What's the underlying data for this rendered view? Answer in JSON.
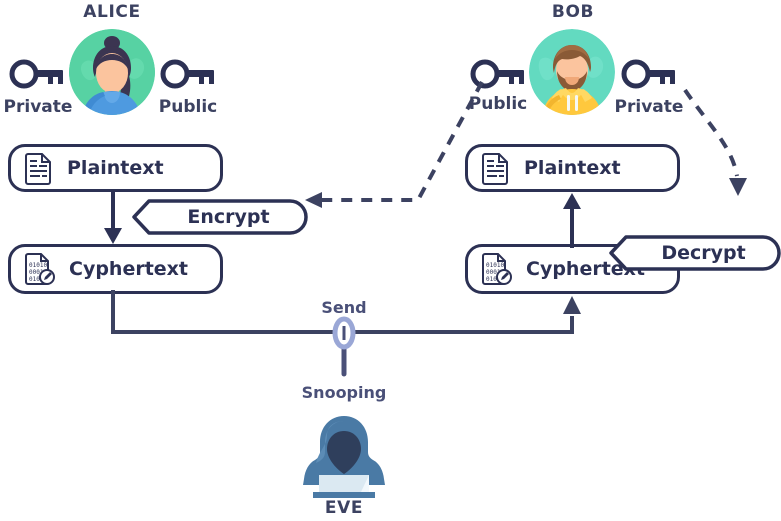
{
  "diagram": {
    "title_alice": "ALICE",
    "title_bob": "BOB",
    "title_eve": "EVE"
  },
  "alice": {
    "name": "ALICE",
    "private_key_label": "Private",
    "public_key_label": "Public",
    "avatar_icon": "woman-avatar-icon",
    "private_key_icon": "key-icon",
    "public_key_icon": "key-icon"
  },
  "bob": {
    "name": "BOB",
    "public_key_label": "Public",
    "private_key_label": "Private",
    "avatar_icon": "man-avatar-icon",
    "public_key_icon": "key-icon",
    "private_key_icon": "key-icon"
  },
  "eve": {
    "name": "EVE",
    "avatar_icon": "hacker-avatar-icon"
  },
  "left_flow": {
    "plaintext_label": "Plaintext",
    "plaintext_icon": "document-icon",
    "ciphertext_label": "Cyphertext",
    "ciphertext_icon": "encrypted-document-icon",
    "action_label": "Encrypt"
  },
  "right_flow": {
    "plaintext_label": "Plaintext",
    "plaintext_icon": "document-icon",
    "ciphertext_label": "Cyphertext",
    "ciphertext_icon": "encrypted-document-icon",
    "action_label": "Decrypt"
  },
  "channel": {
    "send_label": "Send",
    "snooping_label": "Snooping",
    "snooping_icon": "magnifying-glass-icon"
  },
  "colors": {
    "ink": "#2c3154",
    "muted_ink": "#3c4261",
    "mid_ink": "#4a5078",
    "alice_bg": "#5ed6a8",
    "bob_bg": "#63dac0",
    "eve_body": "#4a7aa5",
    "lens": "#9aa7d6",
    "background": "#ffffff"
  }
}
